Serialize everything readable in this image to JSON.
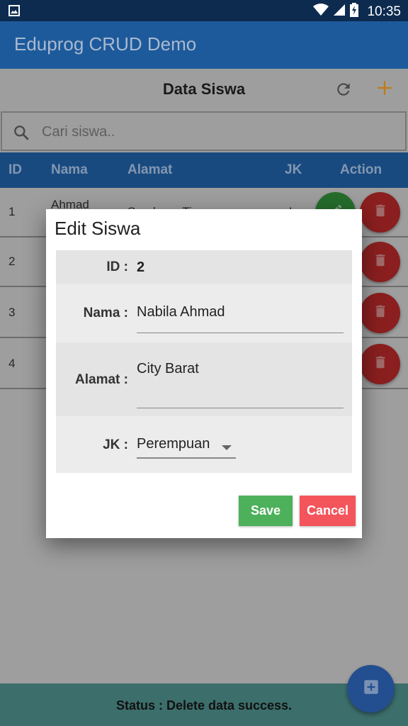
{
  "status_bar": {
    "time": "10:35"
  },
  "app_bar": {
    "title": "Eduprog CRUD Demo"
  },
  "toolbar": {
    "title": "Data Siswa"
  },
  "search": {
    "placeholder": "Cari siswa..",
    "value": ""
  },
  "table": {
    "headers": {
      "id": "ID",
      "nama": "Nama",
      "alamat": "Alamat",
      "jk": "JK",
      "action": "Action"
    },
    "rows": [
      {
        "id": "1",
        "nama": "Ahmad",
        "alamat": "Surabaya Timur",
        "jk": "L"
      },
      {
        "id": "2",
        "nama": "",
        "alamat": "",
        "jk": ""
      },
      {
        "id": "3",
        "nama": "",
        "alamat": "",
        "jk": ""
      },
      {
        "id": "4",
        "nama": "",
        "alamat": "",
        "jk": ""
      }
    ]
  },
  "dialog": {
    "title": "Edit Siswa",
    "id_label": "ID :",
    "id_value": "2",
    "nama_label": "Nama :",
    "nama_value": "Nabila Ahmad",
    "alamat_label": "Alamat :",
    "alamat_value": "City Barat",
    "jk_label": "JK :",
    "jk_value": "Perempuan",
    "save_label": "Save",
    "cancel_label": "Cancel"
  },
  "footer": {
    "status": "Status : Delete data success."
  },
  "colors": {
    "app_bar": "#1d5a9b",
    "save": "#4db05a",
    "cancel": "#f4545b",
    "edit_button": "#256d2c",
    "delete_button": "#8b1f1f",
    "fab": "#234e8f",
    "add_accent": "#f39c12"
  },
  "icons": {
    "status_left": "image-icon",
    "wifi": "wifi-icon",
    "signal": "signal-icon",
    "battery": "battery-charging-icon",
    "refresh": "refresh-icon",
    "add": "plus-icon",
    "search": "search-icon",
    "edit": "pencil-icon",
    "delete": "trash-icon",
    "fab": "add-box-icon",
    "dropdown": "caret-down-icon"
  }
}
